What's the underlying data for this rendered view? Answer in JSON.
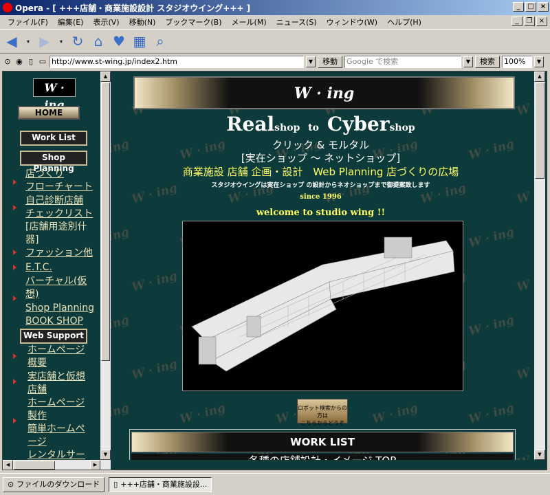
{
  "window": {
    "title": "Opera - [ +++店舗・商業施設設計 スタジオウイング+++ ]",
    "controls": [
      "_",
      "□",
      "×"
    ]
  },
  "menu": [
    "ファイル(F)",
    "編集(E)",
    "表示(V)",
    "移動(N)",
    "ブックマーク(B)",
    "メール(M)",
    "ニュース(S)",
    "ウィンドウ(W)",
    "ヘルプ(H)"
  ],
  "toolbar": {
    "icons": [
      "back-icon",
      "forward-icon",
      "reload-icon",
      "home-icon",
      "hotlist-icon",
      "print-icon",
      "search-icon"
    ]
  },
  "address": {
    "url": "http://www.st-wing.jp/index2.htm",
    "go_label": "移動",
    "search_placeholder": "Google で検索",
    "search_label": "検索",
    "zoom": "100%"
  },
  "sidebar": {
    "logo": "W · ing",
    "home": "HOME",
    "work_list": "Work List",
    "shop_planning": "Shop Planning",
    "links": [
      {
        "lines": [
          "店づくり",
          "フローチャート"
        ]
      },
      {
        "lines": [
          "自己診断店舗",
          "チェックリスト"
        ]
      },
      {
        "lines": [
          "[店舗用途別什",
          "器]"
        ]
      },
      {
        "lines": [
          "ファッション他"
        ]
      },
      {
        "lines": [
          "E.T.C."
        ]
      },
      {
        "lines": [
          "バーチャル(仮",
          "想)"
        ]
      },
      {
        "lines": [
          "Shop Planning",
          "BOOK SHOP"
        ]
      }
    ],
    "web_support": "Web Support",
    "links2": [
      {
        "lines": [
          "ホームページ",
          "概要"
        ]
      },
      {
        "lines": [
          "実店舗と仮想",
          "店舗",
          "ホームページ",
          "製作"
        ]
      },
      {
        "lines": [
          "簡単ホームペ",
          "ージ",
          "レンタルサー"
        ]
      }
    ]
  },
  "main": {
    "header_logo": "W · ing",
    "tagline1_a": "Real",
    "tagline1_b": "shop",
    "tagline1_c": "to",
    "tagline1_d": "Cyber",
    "tagline1_e": "shop",
    "tagline2": "クリック & モルタル",
    "tagline3": "[実在ショップ ～ ネットショップ]",
    "tagline4": "商業施設 店舗 企画・設計　Web Planning 店づくりの広場",
    "tagline5": "スタジオウイングは実在ショップ の設計からネオショップまで御提案致します",
    "since": "since 1996",
    "welcome": "welcome to studio wing !!",
    "robot_button": [
      "ロボット検索からの方は",
      "こちらからどうぞ"
    ],
    "worklist_title": "WORK LIST",
    "worklist_sub": "各種の店舗設計・イメージ TOP",
    "watermark": "W · ing"
  },
  "status": {
    "tabs": [
      "ファイルのダウンロード",
      "+++店舗・商業施設設..."
    ]
  }
}
